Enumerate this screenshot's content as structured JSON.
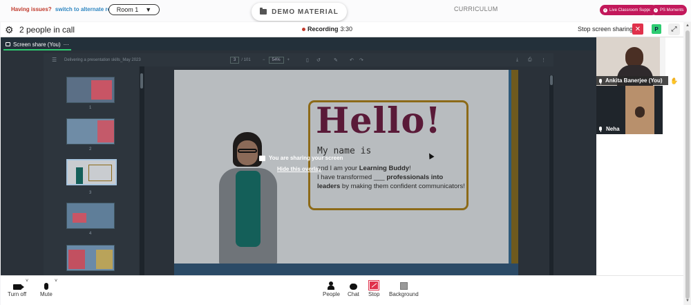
{
  "topbar": {
    "issues_question": "Having issues?",
    "issues_link": "switch to alternate room",
    "room_label": "Room 1",
    "room_caret": "▼",
    "demo_material": "DEMO MATERIAL",
    "curriculum": "CURRICULUM",
    "live_support": "Live Classroom Support",
    "ps_moments": "PS Moments",
    "brand_color": "#c2185b"
  },
  "call": {
    "count_label": "2 people in call",
    "recording_label": "Recording",
    "recording_time": "3:30",
    "stop_screen_sharing": "Stop screen sharing",
    "close_symbol": "✕",
    "participant_initial": "P",
    "expand_symbol": "⤢"
  },
  "share_tab": {
    "label": "Screen share (You)",
    "more": "···"
  },
  "pdf": {
    "filename": "Delivering a presentation skills_May 2023",
    "page_current": "3",
    "page_total": "/ 101",
    "zoom": "54%",
    "zoom_out": "−",
    "zoom_in": "+",
    "thumbnail_numbers": [
      "1",
      "2",
      "3",
      "4"
    ]
  },
  "slide": {
    "hello": "Hello!",
    "my_name": "My name is",
    "line1_pre": "and I am your ",
    "line1_bold": "Learning Buddy",
    "line1_post": "!",
    "line2_pre": "I have transformed ___ ",
    "line2_bold": "professionals into leaders",
    "line2_post": " by making them confident communicators!"
  },
  "overlay": {
    "sharing_message": "You are sharing your screen",
    "hide_link": "Hide this overlay"
  },
  "participants": [
    {
      "name": "Ankita Banerjee (You)"
    },
    {
      "name": "Neha"
    }
  ],
  "toolbar": {
    "turn_off": "Turn off",
    "mute": "Mute",
    "people": "People",
    "chat": "Chat",
    "stop": "Stop",
    "background": "Background",
    "caret": "˅"
  }
}
